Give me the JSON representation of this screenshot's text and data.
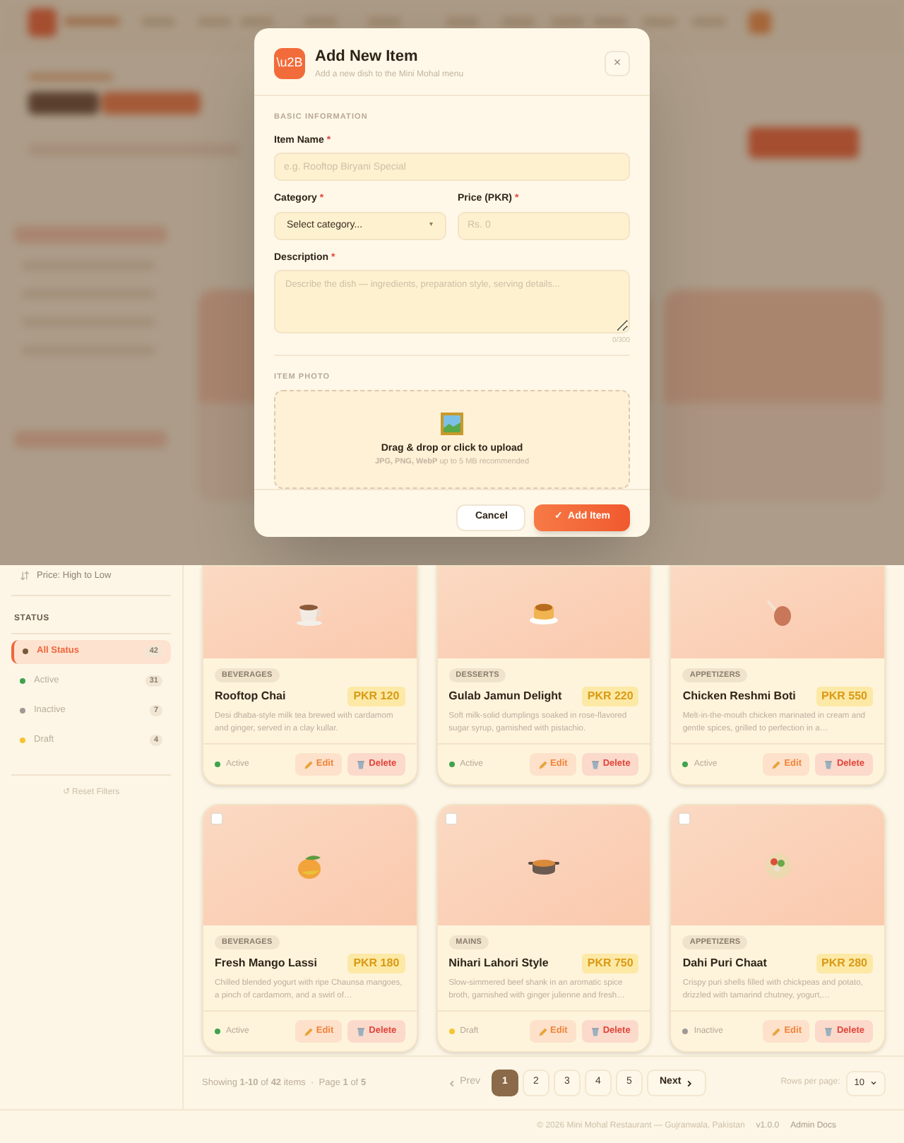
{
  "dialog": {
    "logo": "\\u2B",
    "title": "Add New Item",
    "subtitle": "Add a new dish to the Mini Mohal menu",
    "close": "×",
    "section_basic": "BASIC INFORMATION",
    "item_name": {
      "label": "Item Name",
      "required": "*",
      "placeholder": "e.g. Rooftop Biryani Special"
    },
    "category": {
      "label": "Category",
      "required": "*",
      "value": "Select category...",
      "caret": "▾"
    },
    "price": {
      "label": "Price (PKR)",
      "required": "*",
      "placeholder": "Rs. 0"
    },
    "description": {
      "label": "Description",
      "required": "*",
      "placeholder": "Describe the dish — ingredients, preparation style, serving details...",
      "counter": "0/300"
    },
    "section_photo": "ITEM PHOTO",
    "upload": {
      "title": "Drag & drop or click to upload",
      "hint": "**JPG, PNG, WebP** up to 5 MB recommended"
    },
    "buttons": [
      {
        "label": "Cancel",
        "kind": "secondary"
      },
      {
        "label": "✓  Add Item",
        "kind": "primary"
      }
    ]
  },
  "sidebar": {
    "sort_option": "Price: High to Low",
    "status_heading": "STATUS",
    "status_items": [
      {
        "label": "All Status",
        "count": "42",
        "color": "#7a5a3a",
        "selected": true
      },
      {
        "label": "Active",
        "count": "31",
        "color": "#3fa34d",
        "selected": false
      },
      {
        "label": "Inactive",
        "count": "7",
        "color": "#a09a94",
        "selected": false
      },
      {
        "label": "Draft",
        "count": "4",
        "color": "#f5c431",
        "selected": false
      }
    ],
    "reset": "↺ Reset Filters"
  },
  "cards": [
    {
      "category": "BEVERAGES",
      "name": "Rooftop Chai",
      "price": "PKR 120",
      "description": "Desi dhaba-style milk tea brewed with cardamom and ginger, served in a clay kullar.",
      "status": "Active",
      "color": "#3fa34d",
      "edit": "Edit",
      "delete": "Delete"
    },
    {
      "category": "DESSERTS",
      "name": "Gulab Jamun Delight",
      "price": "PKR 220",
      "description": "Soft milk-solid dumplings soaked in rose-flavored sugar syrup, garnished with pistachio.",
      "status": "Active",
      "color": "#3fa34d",
      "edit": "Edit",
      "delete": "Delete"
    },
    {
      "category": "APPETIZERS",
      "name": "Chicken Reshmi Boti",
      "price": "PKR 550",
      "description": "Melt-in-the-mouth chicken marinated in cream and gentle spices, grilled to perfection in a…",
      "status": "Active",
      "color": "#3fa34d",
      "edit": "Edit",
      "delete": "Delete"
    },
    {
      "category": "BEVERAGES",
      "name": "Fresh Mango Lassi",
      "price": "PKR 180",
      "description": "Chilled blended yogurt with ripe Chaunsa mangoes, a pinch of cardamom, and a swirl of…",
      "status": "Active",
      "color": "#3fa34d",
      "edit": "Edit",
      "delete": "Delete",
      "checked": false
    },
    {
      "category": "MAINS",
      "name": "Nihari Lahori Style",
      "price": "PKR 750",
      "description": "Slow-simmered beef shank in an aromatic spice broth, garnished with ginger julienne and fresh…",
      "status": "Draft",
      "color": "#f5c431",
      "edit": "Edit",
      "delete": "Delete",
      "checked": false
    },
    {
      "category": "APPETIZERS",
      "name": "Dahi Puri Chaat",
      "price": "PKR 280",
      "description": "Crispy puri shells filled with chickpeas and potato, drizzled with tamarind chutney, yogurt,…",
      "status": "Inactive",
      "color": "#a09a94",
      "edit": "Edit",
      "delete": "Delete",
      "checked": false
    }
  ],
  "pagination": {
    "summary": "Showing **1-10** of **42** items  ·  Page **1** of **5**",
    "prev": "Prev",
    "pages": [
      {
        "label": "1",
        "selected": true
      },
      {
        "label": "2",
        "selected": false
      },
      {
        "label": "3",
        "selected": false
      },
      {
        "label": "4",
        "selected": false
      },
      {
        "label": "5",
        "selected": false
      }
    ],
    "next": "Next",
    "rows_label": "Rows per page:",
    "rows_value": "10"
  },
  "footer": {
    "copyright": "© 2026 Mini Mohal Restaurant — Gujranwala, Pakistan",
    "version": "v1.0.0",
    "link": "Admin Docs"
  }
}
